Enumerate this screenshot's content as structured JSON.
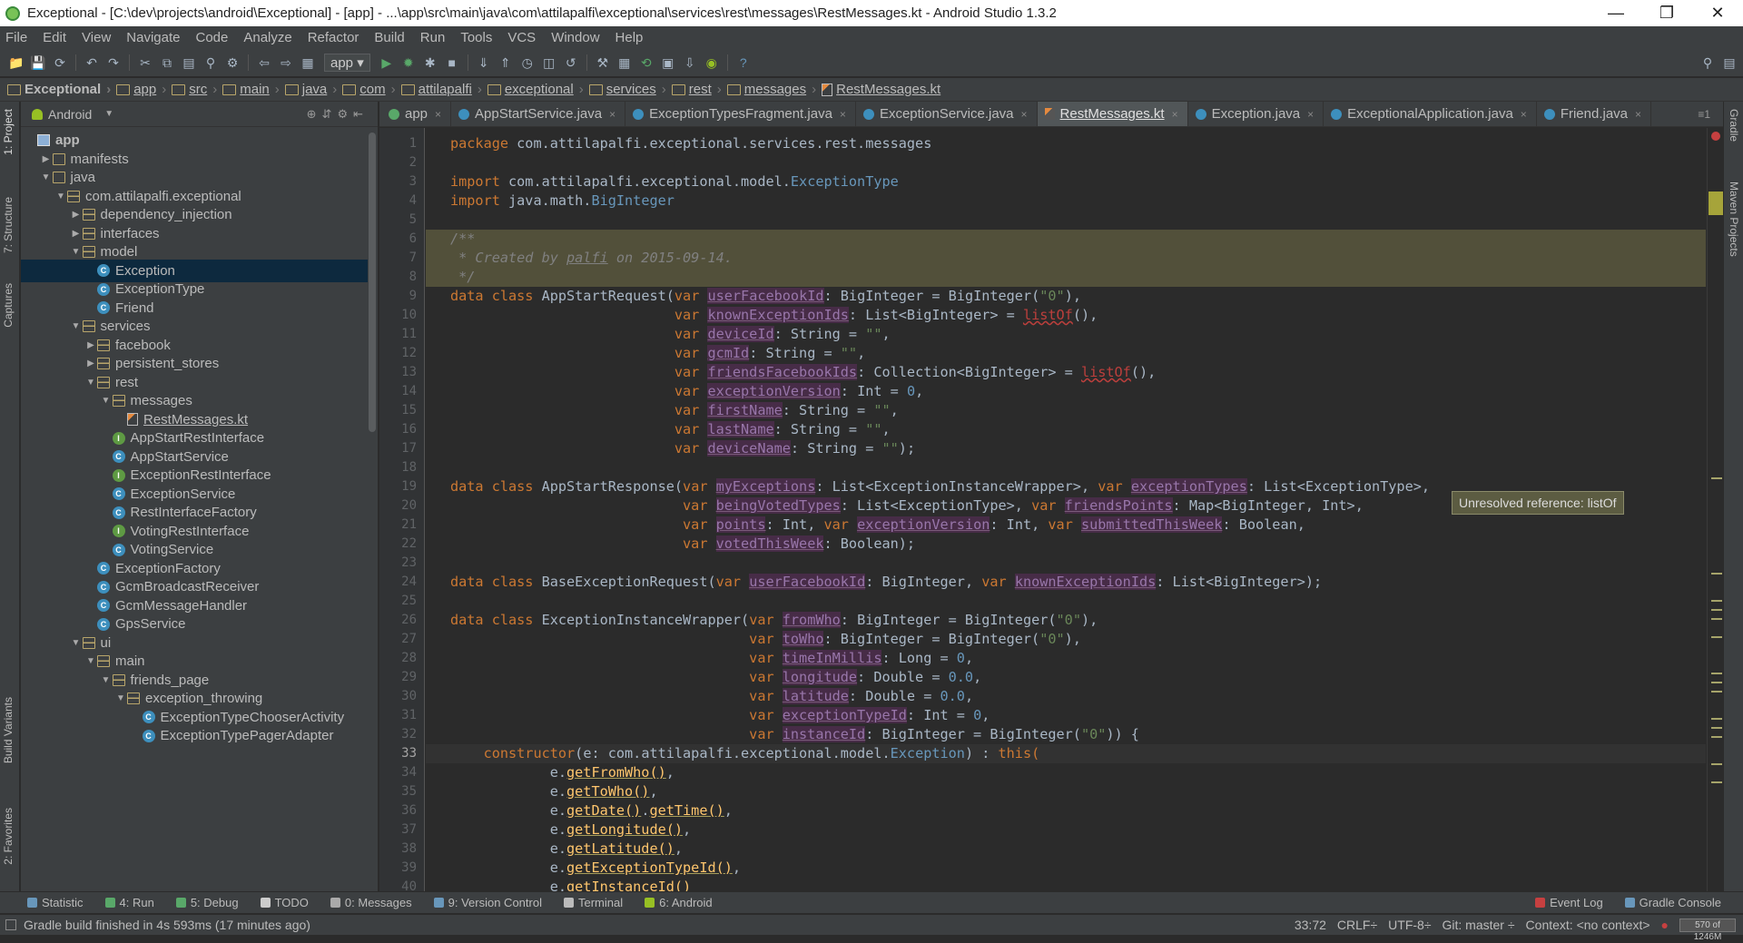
{
  "window": {
    "title": "Exceptional - [C:\\dev\\projects\\android\\Exceptional] - [app] - ...\\app\\src\\main\\java\\com\\attilapalfi\\exceptional\\services\\rest\\messages\\RestMessages.kt - Android Studio 1.3.2"
  },
  "menu": [
    "File",
    "Edit",
    "View",
    "Navigate",
    "Code",
    "Analyze",
    "Refactor",
    "Build",
    "Run",
    "Tools",
    "VCS",
    "Window",
    "Help"
  ],
  "toolbar": {
    "run_config": "app"
  },
  "breadcrumbs": [
    "Exceptional",
    "app",
    "src",
    "main",
    "java",
    "com",
    "attilapalfi",
    "exceptional",
    "services",
    "rest",
    "messages",
    "RestMessages.kt"
  ],
  "left_strip": [
    "1: Project",
    "7: Structure",
    "Captures",
    "Build Variants",
    "2: Favorites"
  ],
  "right_strip": [
    "Gradle",
    "Maven Projects"
  ],
  "project": {
    "view_mode": "Android",
    "tree": [
      {
        "label": "app",
        "depth": 0,
        "icon": "module",
        "arrow": ""
      },
      {
        "label": "manifests",
        "depth": 1,
        "icon": "folder",
        "arrow": "right"
      },
      {
        "label": "java",
        "depth": 1,
        "icon": "folder",
        "arrow": "down"
      },
      {
        "label": "com.attilapalfi.exceptional",
        "depth": 2,
        "icon": "package",
        "arrow": "down"
      },
      {
        "label": "dependency_injection",
        "depth": 3,
        "icon": "package",
        "arrow": "right"
      },
      {
        "label": "interfaces",
        "depth": 3,
        "icon": "package",
        "arrow": "right"
      },
      {
        "label": "model",
        "depth": 3,
        "icon": "package",
        "arrow": "down"
      },
      {
        "label": "Exception",
        "depth": 4,
        "icon": "class",
        "arrow": "",
        "selected": true
      },
      {
        "label": "ExceptionType",
        "depth": 4,
        "icon": "class",
        "arrow": ""
      },
      {
        "label": "Friend",
        "depth": 4,
        "icon": "class",
        "arrow": ""
      },
      {
        "label": "services",
        "depth": 3,
        "icon": "package",
        "arrow": "down"
      },
      {
        "label": "facebook",
        "depth": 4,
        "icon": "package",
        "arrow": "right"
      },
      {
        "label": "persistent_stores",
        "depth": 4,
        "icon": "package",
        "arrow": "right"
      },
      {
        "label": "rest",
        "depth": 4,
        "icon": "package",
        "arrow": "down"
      },
      {
        "label": "messages",
        "depth": 5,
        "icon": "package",
        "arrow": "down"
      },
      {
        "label": "RestMessages.kt",
        "depth": 6,
        "icon": "kotlin",
        "arrow": ""
      },
      {
        "label": "AppStartRestInterface",
        "depth": 5,
        "icon": "interface",
        "arrow": ""
      },
      {
        "label": "AppStartService",
        "depth": 5,
        "icon": "class",
        "arrow": ""
      },
      {
        "label": "ExceptionRestInterface",
        "depth": 5,
        "icon": "interface",
        "arrow": ""
      },
      {
        "label": "ExceptionService",
        "depth": 5,
        "icon": "class",
        "arrow": ""
      },
      {
        "label": "RestInterfaceFactory",
        "depth": 5,
        "icon": "class",
        "arrow": ""
      },
      {
        "label": "VotingRestInterface",
        "depth": 5,
        "icon": "interface",
        "arrow": ""
      },
      {
        "label": "VotingService",
        "depth": 5,
        "icon": "class",
        "arrow": ""
      },
      {
        "label": "ExceptionFactory",
        "depth": 4,
        "icon": "class",
        "arrow": ""
      },
      {
        "label": "GcmBroadcastReceiver",
        "depth": 4,
        "icon": "class",
        "arrow": ""
      },
      {
        "label": "GcmMessageHandler",
        "depth": 4,
        "icon": "class",
        "arrow": ""
      },
      {
        "label": "GpsService",
        "depth": 4,
        "icon": "class",
        "arrow": ""
      },
      {
        "label": "ui",
        "depth": 3,
        "icon": "package",
        "arrow": "down"
      },
      {
        "label": "main",
        "depth": 4,
        "icon": "package",
        "arrow": "down"
      },
      {
        "label": "friends_page",
        "depth": 5,
        "icon": "package",
        "arrow": "down"
      },
      {
        "label": "exception_throwing",
        "depth": 6,
        "icon": "package",
        "arrow": "down"
      },
      {
        "label": "ExceptionTypeChooserActivity",
        "depth": 7,
        "icon": "class",
        "arrow": ""
      },
      {
        "label": "ExceptionTypePagerAdapter",
        "depth": 7,
        "icon": "class",
        "arrow": ""
      }
    ]
  },
  "tabs": [
    {
      "label": "app",
      "icon": "module"
    },
    {
      "label": "AppStartService.java",
      "icon": "class"
    },
    {
      "label": "ExceptionTypesFragment.java",
      "icon": "class"
    },
    {
      "label": "ExceptionService.java",
      "icon": "class"
    },
    {
      "label": "RestMessages.kt",
      "icon": "kotlin",
      "active": true
    },
    {
      "label": "Exception.java",
      "icon": "class"
    },
    {
      "label": "ExceptionalApplication.java",
      "icon": "class"
    },
    {
      "label": "Friend.java",
      "icon": "class"
    }
  ],
  "tab_overflow": "≡1",
  "editor": {
    "current_line": 33,
    "comment_lines": [
      6,
      7,
      8
    ],
    "lines": [
      [
        [
          "k",
          "package "
        ],
        [
          "p",
          "com.attilapalfi.exceptional.services.rest.messages"
        ]
      ],
      [],
      [
        [
          "k",
          "import "
        ],
        [
          "p",
          "com.attilapalfi.exceptional.model."
        ],
        [
          "t",
          "ExceptionType"
        ]
      ],
      [
        [
          "k",
          "import "
        ],
        [
          "p",
          "java.math."
        ],
        [
          "t",
          "BigInteger"
        ]
      ],
      [],
      [
        [
          "c",
          "/**"
        ]
      ],
      [
        [
          "c",
          " * Created by "
        ],
        [
          "cu",
          "palfi"
        ],
        [
          "c",
          " on 2015-09-14."
        ]
      ],
      [
        [
          "c",
          " */"
        ]
      ],
      [
        [
          "k",
          "data class "
        ],
        [
          "p",
          "AppStartRequest("
        ],
        [
          "k",
          "var "
        ],
        [
          "h",
          "userFacebookId"
        ],
        [
          "p",
          ": BigInteger = BigInteger("
        ],
        [
          "s",
          "\"0\""
        ],
        [
          "p",
          "),"
        ]
      ],
      [
        [
          "p",
          "                           "
        ],
        [
          "k",
          "var "
        ],
        [
          "h",
          "knownExceptionIds"
        ],
        [
          "p",
          ": List<BigInteger> = "
        ],
        [
          "u",
          "listOf"
        ],
        [
          "p",
          "(),"
        ]
      ],
      [
        [
          "p",
          "                           "
        ],
        [
          "k",
          "var "
        ],
        [
          "h",
          "deviceId"
        ],
        [
          "p",
          ": String = "
        ],
        [
          "s",
          "\"\""
        ],
        [
          "p",
          ","
        ]
      ],
      [
        [
          "p",
          "                           "
        ],
        [
          "k",
          "var "
        ],
        [
          "h",
          "gcmId"
        ],
        [
          "p",
          ": String = "
        ],
        [
          "s",
          "\"\""
        ],
        [
          "p",
          ","
        ]
      ],
      [
        [
          "p",
          "                           "
        ],
        [
          "k",
          "var "
        ],
        [
          "h",
          "friendsFacebookIds"
        ],
        [
          "p",
          ": Collection<BigInteger> = "
        ],
        [
          "u",
          "listOf"
        ],
        [
          "p",
          "(),"
        ]
      ],
      [
        [
          "p",
          "                           "
        ],
        [
          "k",
          "var "
        ],
        [
          "h",
          "exceptionVersion"
        ],
        [
          "p",
          ": Int = "
        ],
        [
          "n",
          "0"
        ],
        [
          "p",
          ","
        ]
      ],
      [
        [
          "p",
          "                           "
        ],
        [
          "k",
          "var "
        ],
        [
          "h",
          "firstName"
        ],
        [
          "p",
          ": String = "
        ],
        [
          "s",
          "\"\""
        ],
        [
          "p",
          ","
        ]
      ],
      [
        [
          "p",
          "                           "
        ],
        [
          "k",
          "var "
        ],
        [
          "h",
          "lastName"
        ],
        [
          "p",
          ": String = "
        ],
        [
          "s",
          "\"\""
        ],
        [
          "p",
          ","
        ]
      ],
      [
        [
          "p",
          "                           "
        ],
        [
          "k",
          "var "
        ],
        [
          "h",
          "deviceName"
        ],
        [
          "p",
          ": String = "
        ],
        [
          "s",
          "\"\""
        ],
        [
          "p",
          ");"
        ]
      ],
      [],
      [
        [
          "k",
          "data class "
        ],
        [
          "p",
          "AppStartResponse("
        ],
        [
          "k",
          "var "
        ],
        [
          "h",
          "myExceptions"
        ],
        [
          "p",
          ": List<ExceptionInstanceWrapper>, "
        ],
        [
          "k",
          "var "
        ],
        [
          "h",
          "exceptionTypes"
        ],
        [
          "p",
          ": List<ExceptionType>,"
        ]
      ],
      [
        [
          "p",
          "                            "
        ],
        [
          "k",
          "var "
        ],
        [
          "h",
          "beingVotedTypes"
        ],
        [
          "p",
          ": List<ExceptionType>, "
        ],
        [
          "k",
          "var "
        ],
        [
          "h",
          "friendsPoints"
        ],
        [
          "p",
          ": Map<BigInteger, Int>,"
        ]
      ],
      [
        [
          "p",
          "                            "
        ],
        [
          "k",
          "var "
        ],
        [
          "h",
          "points"
        ],
        [
          "p",
          ": Int, "
        ],
        [
          "k",
          "var "
        ],
        [
          "h",
          "exceptionVersion"
        ],
        [
          "p",
          ": Int, "
        ],
        [
          "k",
          "var "
        ],
        [
          "h",
          "submittedThisWeek"
        ],
        [
          "p",
          ": Boolean,"
        ]
      ],
      [
        [
          "p",
          "                            "
        ],
        [
          "k",
          "var "
        ],
        [
          "h",
          "votedThisWeek"
        ],
        [
          "p",
          ": Boolean);"
        ]
      ],
      [],
      [
        [
          "k",
          "data class "
        ],
        [
          "p",
          "BaseExceptionRequest("
        ],
        [
          "k",
          "var "
        ],
        [
          "h",
          "userFacebookId"
        ],
        [
          "p",
          ": BigInteger, "
        ],
        [
          "k",
          "var "
        ],
        [
          "h",
          "knownExceptionIds"
        ],
        [
          "p",
          ": List<BigInteger>);"
        ]
      ],
      [],
      [
        [
          "k",
          "data class "
        ],
        [
          "p",
          "ExceptionInstanceWrapper("
        ],
        [
          "k",
          "var "
        ],
        [
          "h",
          "fromWho"
        ],
        [
          "p",
          ": BigInteger = BigInteger("
        ],
        [
          "s",
          "\"0\""
        ],
        [
          "p",
          "),"
        ]
      ],
      [
        [
          "p",
          "                                    "
        ],
        [
          "k",
          "var "
        ],
        [
          "h",
          "toWho"
        ],
        [
          "p",
          ": BigInteger = BigInteger("
        ],
        [
          "s",
          "\"0\""
        ],
        [
          "p",
          "),"
        ]
      ],
      [
        [
          "p",
          "                                    "
        ],
        [
          "k",
          "var "
        ],
        [
          "h",
          "timeInMillis"
        ],
        [
          "p",
          ": Long = "
        ],
        [
          "n",
          "0"
        ],
        [
          "p",
          ","
        ]
      ],
      [
        [
          "p",
          "                                    "
        ],
        [
          "k",
          "var "
        ],
        [
          "h",
          "longitude"
        ],
        [
          "p",
          ": Double = "
        ],
        [
          "n",
          "0.0"
        ],
        [
          "p",
          ","
        ]
      ],
      [
        [
          "p",
          "                                    "
        ],
        [
          "k",
          "var "
        ],
        [
          "h",
          "latitude"
        ],
        [
          "p",
          ": Double = "
        ],
        [
          "n",
          "0.0"
        ],
        [
          "p",
          ","
        ]
      ],
      [
        [
          "p",
          "                                    "
        ],
        [
          "k",
          "var "
        ],
        [
          "h",
          "exceptionTypeId"
        ],
        [
          "p",
          ": Int = "
        ],
        [
          "n",
          "0"
        ],
        [
          "p",
          ","
        ]
      ],
      [
        [
          "p",
          "                                    "
        ],
        [
          "k",
          "var "
        ],
        [
          "h",
          "instanceId"
        ],
        [
          "p",
          ": BigInteger = BigInteger("
        ],
        [
          "s",
          "\"0\""
        ],
        [
          "p",
          ")) {"
        ]
      ],
      [
        [
          "p",
          "    "
        ],
        [
          "k",
          "constructor"
        ],
        [
          "p",
          "(e: com.attilapalfi.exceptional.model."
        ],
        [
          "t",
          "Exception"
        ],
        [
          "p",
          ") : "
        ],
        [
          "k",
          "this("
        ]
      ],
      [
        [
          "p",
          "            e."
        ],
        [
          "f",
          "getFromWho()"
        ],
        [
          "p",
          ","
        ]
      ],
      [
        [
          "p",
          "            e."
        ],
        [
          "f",
          "getToWho()"
        ],
        [
          "p",
          ","
        ]
      ],
      [
        [
          "p",
          "            e."
        ],
        [
          "f",
          "getDate()"
        ],
        [
          "p",
          "."
        ],
        [
          "f",
          "getTime()"
        ],
        [
          "p",
          ","
        ]
      ],
      [
        [
          "p",
          "            e."
        ],
        [
          "f",
          "getLongitude()"
        ],
        [
          "p",
          ","
        ]
      ],
      [
        [
          "p",
          "            e."
        ],
        [
          "f",
          "getLatitude()"
        ],
        [
          "p",
          ","
        ]
      ],
      [
        [
          "p",
          "            e."
        ],
        [
          "f",
          "getExceptionTypeId()"
        ],
        [
          "p",
          ","
        ]
      ],
      [
        [
          "p",
          "            e."
        ],
        [
          "f",
          "getInstanceId()"
        ]
      ]
    ]
  },
  "tooltip": "Unresolved reference: listOf",
  "bottom_tools": [
    "Statistic",
    "4: Run",
    "5: Debug",
    "TODO",
    "0: Messages",
    "9: Version Control",
    "Terminal",
    "6: Android"
  ],
  "bottom_right_tools": [
    "Event Log",
    "Gradle Console"
  ],
  "status": {
    "message": "Gradle build finished in 4s 593ms (17 minutes ago)",
    "position": "33:72",
    "line_sep": "CRLF÷",
    "encoding": "UTF-8÷",
    "vcs": "Git: master ÷",
    "context": "Context: <no context>",
    "memory": "570 of 1246M"
  }
}
